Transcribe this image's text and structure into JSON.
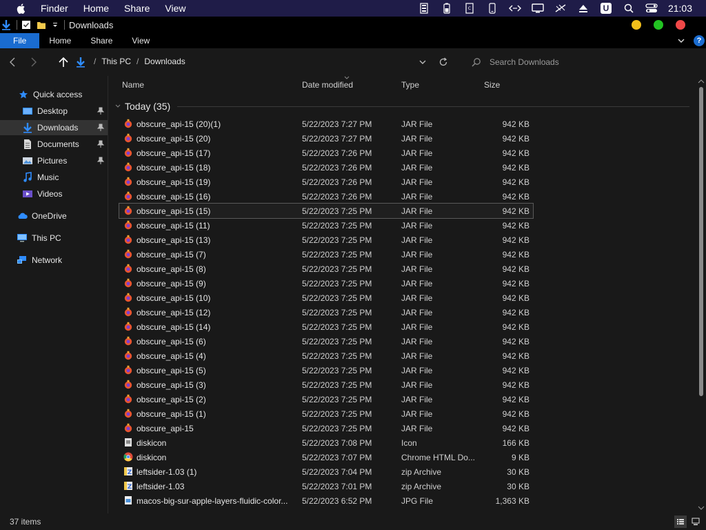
{
  "menubar": {
    "items": [
      "Finder",
      "Home",
      "Share",
      "View"
    ],
    "clock": "21:03",
    "badge_letter": "U"
  },
  "titlebar": {
    "title": "Downloads"
  },
  "window_colors": {
    "minimize": "#f2bf1b",
    "maximize": "#22c322",
    "close": "#f04848"
  },
  "ribbon": {
    "tabs": [
      "File",
      "Home",
      "Share",
      "View"
    ],
    "help": "?"
  },
  "address": {
    "crumbs": [
      "This PC",
      "Downloads"
    ],
    "search_placeholder": "Search Downloads"
  },
  "sidebar": {
    "items": [
      {
        "label": "Quick access",
        "icon": "star-icon",
        "pinned": false
      },
      {
        "label": "Desktop",
        "icon": "desktop-folder-icon",
        "pinned": true
      },
      {
        "label": "Downloads",
        "icon": "download-arrow-icon",
        "pinned": true,
        "active": true
      },
      {
        "label": "Documents",
        "icon": "documents-icon",
        "pinned": true
      },
      {
        "label": "Pictures",
        "icon": "pictures-icon",
        "pinned": true
      },
      {
        "label": "Music",
        "icon": "music-icon",
        "pinned": false
      },
      {
        "label": "Videos",
        "icon": "videos-icon",
        "pinned": false
      },
      {
        "label": "OneDrive",
        "icon": "cloud-icon",
        "pinned": false
      },
      {
        "label": "This PC",
        "icon": "computer-icon",
        "pinned": false
      },
      {
        "label": "Network",
        "icon": "network-icon",
        "pinned": false
      }
    ]
  },
  "columns": {
    "name": "Name",
    "date": "Date modified",
    "type": "Type",
    "size": "Size"
  },
  "group": {
    "label": "Today (35)"
  },
  "files": [
    {
      "name": "obscure_api-15 (20)(1)",
      "date": "5/22/2023 7:27 PM",
      "type": "JAR File",
      "size": "942 KB",
      "icon": "jar"
    },
    {
      "name": "obscure_api-15 (20)",
      "date": "5/22/2023 7:27 PM",
      "type": "JAR File",
      "size": "942 KB",
      "icon": "jar"
    },
    {
      "name": "obscure_api-15 (17)",
      "date": "5/22/2023 7:26 PM",
      "type": "JAR File",
      "size": "942 KB",
      "icon": "jar"
    },
    {
      "name": "obscure_api-15 (18)",
      "date": "5/22/2023 7:26 PM",
      "type": "JAR File",
      "size": "942 KB",
      "icon": "jar"
    },
    {
      "name": "obscure_api-15 (19)",
      "date": "5/22/2023 7:26 PM",
      "type": "JAR File",
      "size": "942 KB",
      "icon": "jar"
    },
    {
      "name": "obscure_api-15 (16)",
      "date": "5/22/2023 7:26 PM",
      "type": "JAR File",
      "size": "942 KB",
      "icon": "jar"
    },
    {
      "name": "obscure_api-15 (15)",
      "date": "5/22/2023 7:25 PM",
      "type": "JAR File",
      "size": "942 KB",
      "icon": "jar",
      "selected": true
    },
    {
      "name": "obscure_api-15 (11)",
      "date": "5/22/2023 7:25 PM",
      "type": "JAR File",
      "size": "942 KB",
      "icon": "jar"
    },
    {
      "name": "obscure_api-15 (13)",
      "date": "5/22/2023 7:25 PM",
      "type": "JAR File",
      "size": "942 KB",
      "icon": "jar"
    },
    {
      "name": "obscure_api-15 (7)",
      "date": "5/22/2023 7:25 PM",
      "type": "JAR File",
      "size": "942 KB",
      "icon": "jar"
    },
    {
      "name": "obscure_api-15 (8)",
      "date": "5/22/2023 7:25 PM",
      "type": "JAR File",
      "size": "942 KB",
      "icon": "jar"
    },
    {
      "name": "obscure_api-15 (9)",
      "date": "5/22/2023 7:25 PM",
      "type": "JAR File",
      "size": "942 KB",
      "icon": "jar"
    },
    {
      "name": "obscure_api-15 (10)",
      "date": "5/22/2023 7:25 PM",
      "type": "JAR File",
      "size": "942 KB",
      "icon": "jar"
    },
    {
      "name": "obscure_api-15 (12)",
      "date": "5/22/2023 7:25 PM",
      "type": "JAR File",
      "size": "942 KB",
      "icon": "jar"
    },
    {
      "name": "obscure_api-15 (14)",
      "date": "5/22/2023 7:25 PM",
      "type": "JAR File",
      "size": "942 KB",
      "icon": "jar"
    },
    {
      "name": "obscure_api-15 (6)",
      "date": "5/22/2023 7:25 PM",
      "type": "JAR File",
      "size": "942 KB",
      "icon": "jar"
    },
    {
      "name": "obscure_api-15 (4)",
      "date": "5/22/2023 7:25 PM",
      "type": "JAR File",
      "size": "942 KB",
      "icon": "jar"
    },
    {
      "name": "obscure_api-15 (5)",
      "date": "5/22/2023 7:25 PM",
      "type": "JAR File",
      "size": "942 KB",
      "icon": "jar"
    },
    {
      "name": "obscure_api-15 (3)",
      "date": "5/22/2023 7:25 PM",
      "type": "JAR File",
      "size": "942 KB",
      "icon": "jar"
    },
    {
      "name": "obscure_api-15 (2)",
      "date": "5/22/2023 7:25 PM",
      "type": "JAR File",
      "size": "942 KB",
      "icon": "jar"
    },
    {
      "name": "obscure_api-15 (1)",
      "date": "5/22/2023 7:25 PM",
      "type": "JAR File",
      "size": "942 KB",
      "icon": "jar"
    },
    {
      "name": "obscure_api-15",
      "date": "5/22/2023 7:25 PM",
      "type": "JAR File",
      "size": "942 KB",
      "icon": "jar"
    },
    {
      "name": "diskicon",
      "date": "5/22/2023 7:08 PM",
      "type": "Icon",
      "size": "166 KB",
      "icon": "ico"
    },
    {
      "name": "diskicon",
      "date": "5/22/2023 7:07 PM",
      "type": "Chrome HTML Do...",
      "size": "9 KB",
      "icon": "chrome"
    },
    {
      "name": "leftsider-1.03 (1)",
      "date": "5/22/2023 7:04 PM",
      "type": "zip Archive",
      "size": "30 KB",
      "icon": "zip"
    },
    {
      "name": "leftsider-1.03",
      "date": "5/22/2023 7:01 PM",
      "type": "zip Archive",
      "size": "30 KB",
      "icon": "zip"
    },
    {
      "name": "macos-big-sur-apple-layers-fluidic-color...",
      "date": "5/22/2023 6:52 PM",
      "type": "JPG File",
      "size": "1,363 KB",
      "icon": "jpg"
    }
  ],
  "status": {
    "count": "37 items"
  }
}
